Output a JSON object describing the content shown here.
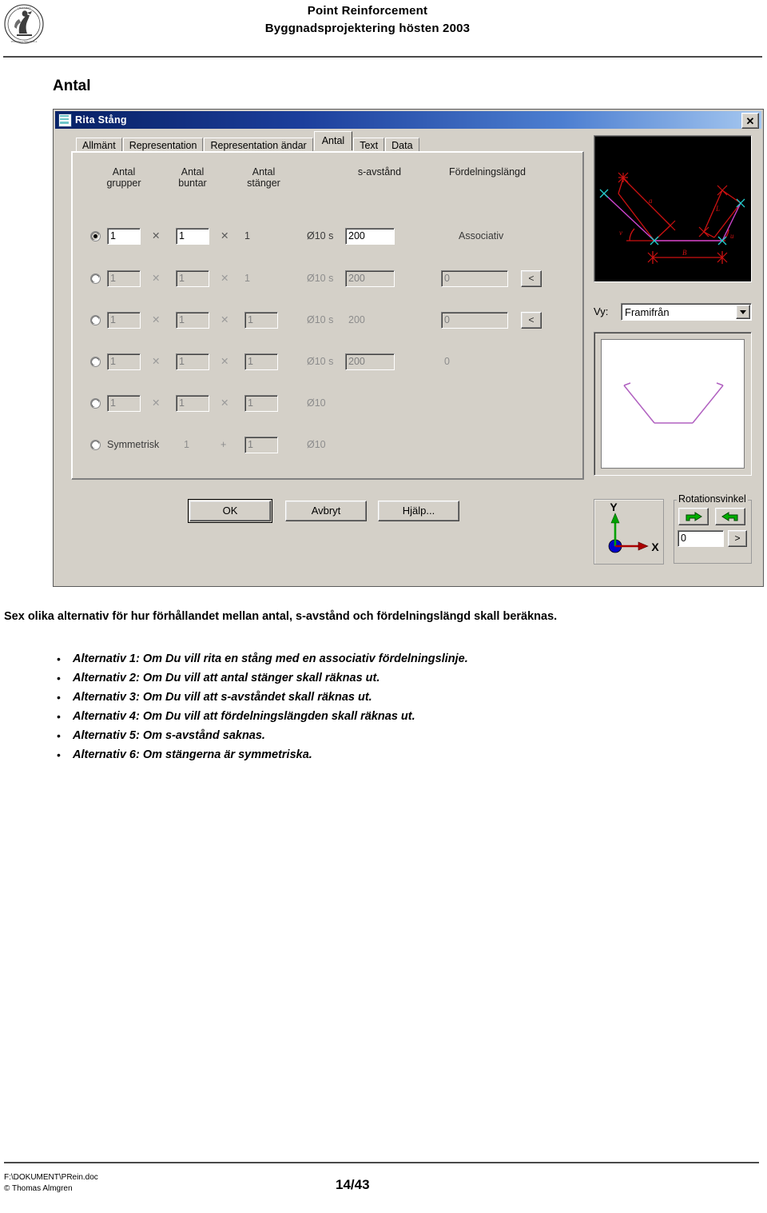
{
  "page_header": {
    "logo": "chalmers-seal-logo",
    "title": "Point Reinforcement",
    "subtitle": "Byggnadsprojektering hösten 2003"
  },
  "section_title": "Antal",
  "dialog": {
    "title": "Rita Stång",
    "window_icon": "application-icon",
    "close_label": "✕",
    "tabs": [
      {
        "label": "Allmänt",
        "active": false
      },
      {
        "label": "Representation",
        "active": false
      },
      {
        "label": "Representation ändar",
        "active": false
      },
      {
        "label": "Antal",
        "active": true
      },
      {
        "label": "Text",
        "active": false
      },
      {
        "label": "Data",
        "active": false
      }
    ],
    "column_headers": [
      {
        "line1": "Antal",
        "line2": "grupper"
      },
      {
        "line1": "Antal",
        "line2": "buntar"
      },
      {
        "line1": "Antal",
        "line2": "stänger"
      },
      {
        "line1": "s-avstånd",
        "line2": ""
      },
      {
        "line1": "Fördelningslängd",
        "line2": ""
      }
    ],
    "rows": [
      {
        "selected": true,
        "grupper": "1",
        "grupper_enabled": true,
        "buntar": "1",
        "buntar_enabled": true,
        "stanger": "1",
        "stanger_is_field": false,
        "stanger_enabled": false,
        "diam": "Ø10 s",
        "diam_enabled": true,
        "savstand": "200",
        "savstand_is_field": true,
        "savstand_enabled": true,
        "fordelning": "Associativ",
        "fordelning_is_field": false,
        "fordelning_enabled": false,
        "has_pick_button": false
      },
      {
        "selected": false,
        "grupper": "1",
        "grupper_enabled": false,
        "buntar": "1",
        "buntar_enabled": false,
        "stanger": "1",
        "stanger_is_field": false,
        "stanger_enabled": false,
        "diam": "Ø10 s",
        "diam_enabled": false,
        "savstand": "200",
        "savstand_is_field": true,
        "savstand_enabled": false,
        "fordelning": "0",
        "fordelning_is_field": true,
        "fordelning_enabled": false,
        "has_pick_button": true,
        "pick_label": "<"
      },
      {
        "selected": false,
        "grupper": "1",
        "grupper_enabled": false,
        "buntar": "1",
        "buntar_enabled": false,
        "stanger": "1",
        "stanger_is_field": true,
        "stanger_enabled": false,
        "diam": "Ø10 s",
        "diam_enabled": false,
        "savstand": "200",
        "savstand_is_field": false,
        "savstand_enabled": false,
        "fordelning": "0",
        "fordelning_is_field": true,
        "fordelning_enabled": false,
        "has_pick_button": true,
        "pick_label": "<"
      },
      {
        "selected": false,
        "grupper": "1",
        "grupper_enabled": false,
        "buntar": "1",
        "buntar_enabled": false,
        "stanger": "1",
        "stanger_is_field": true,
        "stanger_enabled": false,
        "diam": "Ø10 s",
        "diam_enabled": false,
        "savstand": "200",
        "savstand_is_field": true,
        "savstand_enabled": false,
        "fordelning": "0",
        "fordelning_is_field": false,
        "fordelning_enabled": false,
        "has_pick_button": false
      },
      {
        "selected": false,
        "grupper": "1",
        "grupper_enabled": false,
        "buntar": "1",
        "buntar_enabled": false,
        "stanger": "1",
        "stanger_is_field": true,
        "stanger_enabled": false,
        "diam": "Ø10",
        "diam_enabled": false,
        "savstand": "",
        "savstand_is_field": false,
        "savstand_enabled": false,
        "fordelning": "",
        "fordelning_is_field": false,
        "fordelning_enabled": false,
        "has_pick_button": false
      }
    ],
    "symmetric_row": {
      "selected": false,
      "label": "Symmetrisk",
      "left_value": "1",
      "operator": "+",
      "right_value": "1",
      "diam": "Ø10"
    },
    "buttons": {
      "ok": "OK",
      "cancel": "Avbryt",
      "help": "Hjälp..."
    },
    "right_panel": {
      "preview_3d_name": "rebar-3d-preview",
      "view_label": "Vy:",
      "view_value": "Framifrån",
      "preview_2d_name": "rebar-shape-preview",
      "axis_x_label": "X",
      "axis_y_label": "Y",
      "rotation_group_label": "Rotationsvinkel",
      "rotate_cw_icon": "rotate-right-icon",
      "rotate_ccw_icon": "rotate-left-icon",
      "rotation_value": "0",
      "rotation_more_label": ">"
    }
  },
  "body": {
    "lead": "Sex olika alternativ för hur förhållandet mellan antal, s-avstånd och fördelningslängd skall beräknas.",
    "bullets": [
      "Alternativ 1: Om Du vill rita en stång med en associativ fördelningslinje.",
      "Alternativ 2: Om Du vill att antal stänger skall räknas ut.",
      "Alternativ 3: Om Du vill att s-avståndet skall räknas ut.",
      "Alternativ 4: Om Du vill att fördelningslängden skall räknas ut.",
      "Alternativ 5: Om s-avstånd saknas.",
      "Alternativ 6: Om stängerna är symmetriska."
    ]
  },
  "page_footer": {
    "file_path": "F:\\DOKUMENT\\PRein.doc",
    "copyright": "© Thomas Almgren",
    "page_number": "14/43"
  },
  "colors": {
    "dialog_face": "#d4d0c8",
    "titlebar_start": "#0a246a",
    "titlebar_end": "#a6c8f0",
    "preview_bg": "#000000",
    "rebar_red": "#cc1111",
    "rebar_magenta": "#cc44cc",
    "rebar_cyan": "#22cccc",
    "axis_green": "#00a000",
    "axis_blue": "#0000cc"
  }
}
